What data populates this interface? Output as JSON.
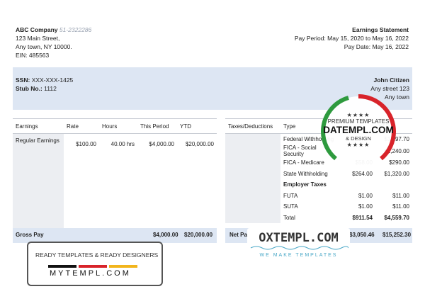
{
  "company": {
    "name": "ABC Company",
    "phone": "51-2322286",
    "address1": "123 Main Street,",
    "address2": "Any town, NY 10000.",
    "ein": "EIN: 485563"
  },
  "statement": {
    "title": "Earnings Statement",
    "pay_period": "Pay Period: May 15, 2020 to May 16, 2022",
    "pay_date": "Pay Date: May 16, 2022"
  },
  "employee": {
    "ssn_label": "SSN:",
    "ssn": "XXX-XXX-1425",
    "stub_label": "Stub No.:",
    "stub": "1112",
    "name": "John Citizen",
    "street": "Any street 123",
    "town": "Any town"
  },
  "earnings": {
    "headers": [
      "Earnings",
      "Rate",
      "Hours",
      "This Period",
      "YTD"
    ],
    "row": {
      "label": "Regular Earnings",
      "rate": "$100.00",
      "hours": "40.00 hrs",
      "period": "$4,000.00",
      "ytd": "$20,000.00"
    }
  },
  "taxes": {
    "headers": [
      "Taxes/Deductions",
      "Type",
      "",
      "YTD"
    ],
    "rows": [
      {
        "type": "Federal Withholding",
        "period": "",
        "ytd": "$1,197.70"
      },
      {
        "type": "FICA - Social Security",
        "period": "",
        "ytd": "$1,240.00"
      },
      {
        "type": "FICA - Medicare",
        "period": "$58.00",
        "ytd": "$290.00"
      },
      {
        "type": "State Withholding",
        "period": "$264.00",
        "ytd": "$1,320.00"
      }
    ],
    "employer_label": "Employer Taxes",
    "employer_rows": [
      {
        "type": "FUTA",
        "period": "$1.00",
        "ytd": "$11.00"
      },
      {
        "type": "SUTA",
        "period": "$1.00",
        "ytd": "$11.00"
      }
    ],
    "total": {
      "label": "Total",
      "period": "$911.54",
      "ytd": "$4,559.70"
    }
  },
  "gross": {
    "label": "Gross Pay",
    "period": "$4,000.00",
    "ytd": "$20,000.00"
  },
  "net": {
    "label": "Net Pay",
    "period": "$3,050.46",
    "ytd": "$15,252.30"
  },
  "watermarks": {
    "mytempl_tagline": "READY TEMPLATES & READY DESIGNERS",
    "mytempl_name": "MYTEMPL.COM",
    "oxtempl_name": "OXTEMPL.COM",
    "oxtempl_tagline": "WE MAKE TEMPLATES",
    "seal_stars": "★★★★",
    "seal_line1": "PREMIUM TEMPLATES",
    "seal_name": "DATEMPL.COM",
    "seal_line2": "& DESIGN"
  },
  "colors": {
    "band": "#dde6f3",
    "seal_red": "#d8232a",
    "seal_green": "#2e9a3e"
  }
}
